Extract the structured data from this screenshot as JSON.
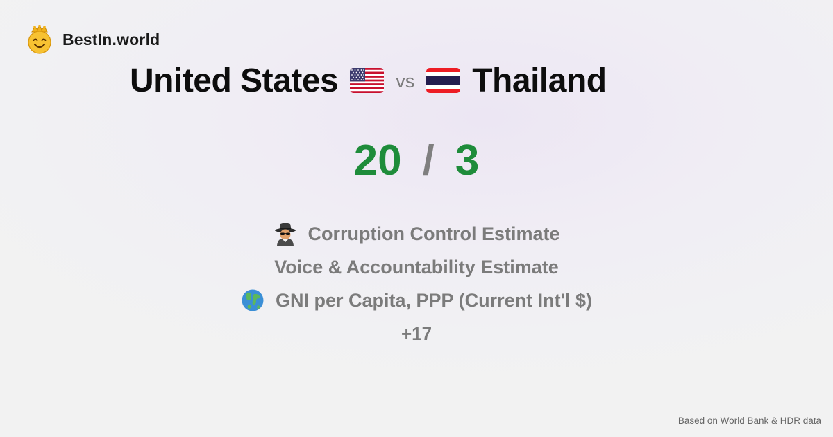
{
  "brand": {
    "name": "BestIn.world",
    "logo_icon": "crowned-smiley-icon"
  },
  "comparison": {
    "country_a": "United States",
    "country_a_flag": "us-flag-icon",
    "vs_label": "vs",
    "country_b": "Thailand",
    "country_b_flag": "thailand-flag-icon"
  },
  "score": {
    "a": "20",
    "separator": "/",
    "b": "3",
    "color": "#1e8c3a"
  },
  "metrics": [
    {
      "icon": "spy-icon",
      "label": "Corruption Control Estimate"
    },
    {
      "icon": "",
      "label": "Voice & Accountability Estimate"
    },
    {
      "icon": "globe-icon",
      "label": "GNI per Capita, PPP (Current Int'l $)"
    }
  ],
  "more_count": "+17",
  "footer": {
    "source": "Based on World Bank & HDR data"
  }
}
